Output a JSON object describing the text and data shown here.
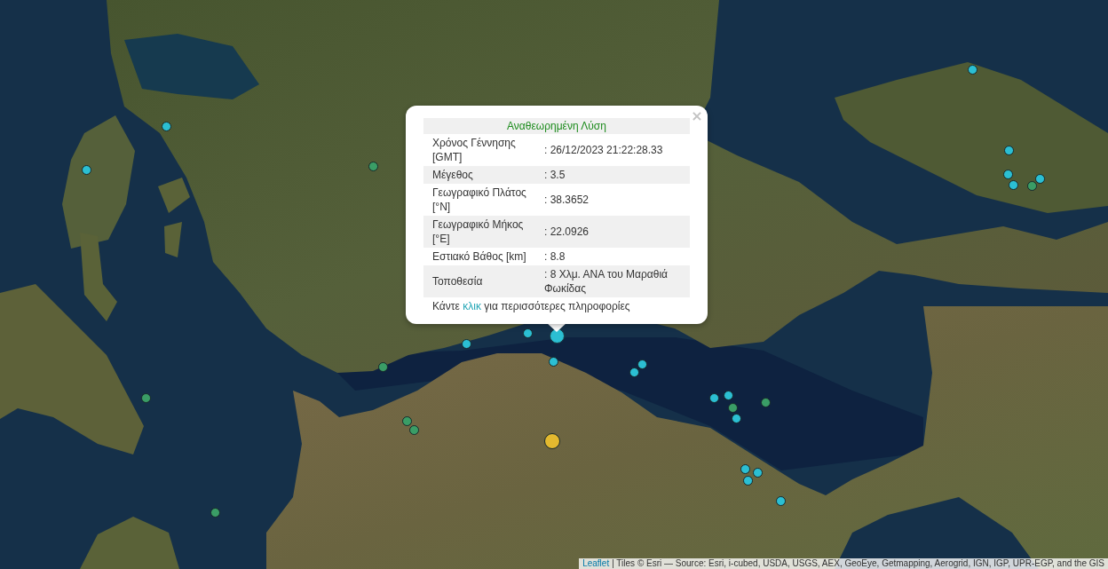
{
  "map": {
    "markers": [
      {
        "color": "#2bbfd3",
        "kind": "small",
        "selected": false
      },
      {
        "color": "#2bbfd3",
        "kind": "small",
        "selected": false
      },
      {
        "color": "#2bbfd3",
        "kind": "small",
        "selected": false
      },
      {
        "color": "#3a9d66",
        "kind": "small",
        "selected": false
      },
      {
        "color": "#2bbfd3",
        "kind": "small",
        "selected": false
      },
      {
        "color": "#2bbfd3",
        "kind": "small",
        "selected": false
      },
      {
        "color": "#2bbfd3",
        "kind": "small",
        "selected": false
      },
      {
        "color": "#3a9d66",
        "kind": "small",
        "selected": false
      },
      {
        "color": "#2bbfd3",
        "kind": "small",
        "selected": false
      },
      {
        "color": "#2bbfd3",
        "kind": "small",
        "selected": false
      },
      {
        "color": "#2bbfd3",
        "kind": "small",
        "selected": true
      },
      {
        "color": "#2bbfd3",
        "kind": "small",
        "selected": false
      },
      {
        "color": "#2bbfd3",
        "kind": "small",
        "selected": false
      },
      {
        "color": "#2bbfd3",
        "kind": "small",
        "selected": false
      },
      {
        "color": "#3a9d66",
        "kind": "small",
        "selected": false
      },
      {
        "color": "#2bbfd3",
        "kind": "small",
        "selected": false
      },
      {
        "color": "#2bbfd3",
        "kind": "small",
        "selected": false
      },
      {
        "color": "#2bbfd3",
        "kind": "small",
        "selected": false
      },
      {
        "color": "#3a9d66",
        "kind": "small",
        "selected": false
      },
      {
        "color": "#3a9d66",
        "kind": "small",
        "selected": false
      },
      {
        "color": "#3a9d66",
        "kind": "small",
        "selected": false
      },
      {
        "color": "#2bbfd3",
        "kind": "small",
        "selected": false
      },
      {
        "color": "#3a9d66",
        "kind": "small",
        "selected": false
      },
      {
        "color": "#3a9d66",
        "kind": "small",
        "selected": false
      },
      {
        "color": "#e3b92f",
        "kind": "large",
        "selected": false
      },
      {
        "color": "#2bbfd3",
        "kind": "small",
        "selected": false
      },
      {
        "color": "#2bbfd3",
        "kind": "small",
        "selected": false
      },
      {
        "color": "#2bbfd3",
        "kind": "small",
        "selected": false
      },
      {
        "color": "#3a9d66",
        "kind": "small",
        "selected": false
      },
      {
        "color": "#2bbfd3",
        "kind": "small",
        "selected": false
      }
    ]
  },
  "popup": {
    "close": "×",
    "title": "Αναθεωρημένη Λύση",
    "rows": [
      {
        "label": "Χρόνος Γέννησης [GMT]",
        "value": ": 26/12/2023 21:22:28.33"
      },
      {
        "label": "Μέγεθος",
        "value": ": 3.5"
      },
      {
        "label": "Γεωγραφικό Πλάτος [°N]",
        "value": ": 38.3652"
      },
      {
        "label": "Γεωγραφικό Μήκος [°E]",
        "value": ": 22.0926"
      },
      {
        "label": "Εστιακό Βάθος [km]",
        "value": ": 8.8"
      },
      {
        "label": "Τοποθεσία",
        "value": ": 8 Χλμ. ΑΝΑ του Μαραθιά Φωκίδας"
      }
    ],
    "more_info": {
      "before": "Κάντε",
      "link": "κλικ",
      "after": "για περισσότερες πληροφορίες"
    }
  },
  "attribution": {
    "link": "Leaflet",
    "text": "| Tiles © Esri — Source: Esri, i-cubed, USDA, USGS, AEX, GeoEye, Getmapping, Aerogrid, IGN, IGP, UPR-EGP, and the GIS"
  }
}
